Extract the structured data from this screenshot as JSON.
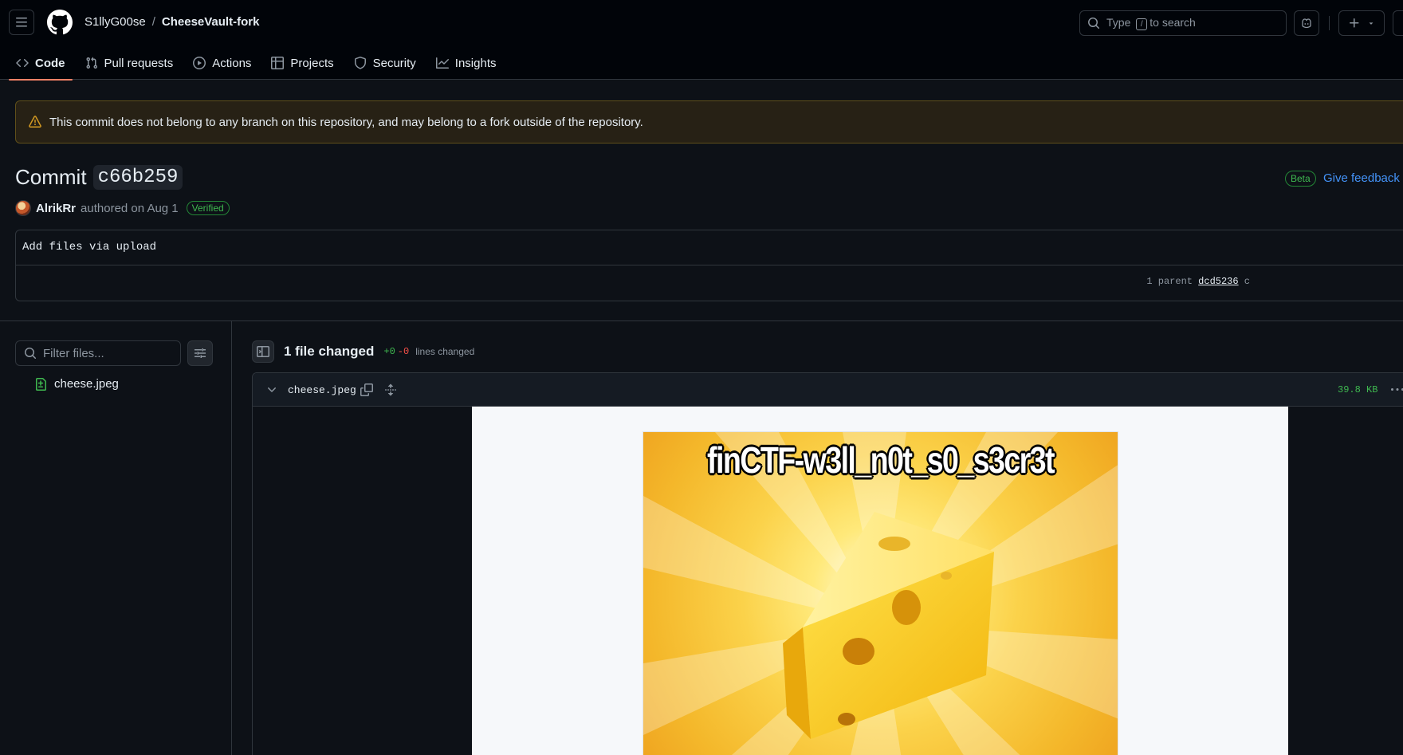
{
  "header": {
    "owner": "S1llyG00se",
    "separator": "/",
    "repo": "CheeseVault-fork",
    "search_prefix": "Type",
    "search_key": "/",
    "search_suffix": "to search"
  },
  "tabs": [
    {
      "label": "Code",
      "icon": "code-icon",
      "active": true
    },
    {
      "label": "Pull requests",
      "icon": "git-pull-request-icon"
    },
    {
      "label": "Actions",
      "icon": "play-icon"
    },
    {
      "label": "Projects",
      "icon": "table-icon"
    },
    {
      "label": "Security",
      "icon": "shield-icon"
    },
    {
      "label": "Insights",
      "icon": "graph-icon"
    }
  ],
  "banner": {
    "text": "This commit does not belong to any branch on this repository, and may belong to a fork outside of the repository.",
    "icon": "alert-icon"
  },
  "commit": {
    "title_word": "Commit",
    "sha": "c66b259",
    "beta": "Beta",
    "feedback": "Give feedback",
    "author": "AlrikRr",
    "authored": "authored on Aug 1",
    "verified": "Verified",
    "message": "Add files via upload",
    "parent_label": "1 parent",
    "parent_sha": "dcd5236",
    "parent_more": "c"
  },
  "sidebar": {
    "filter_placeholder": "Filter files...",
    "files": [
      {
        "name": "cheese.jpeg",
        "status": "added"
      }
    ]
  },
  "diff": {
    "summary": "1 file changed",
    "additions": "+0",
    "deletions": "-0",
    "lines_label": "lines changed",
    "file": {
      "name": "cheese.jpeg",
      "size": "39.8 KB",
      "image_caption": "finCTF-w3ll_n0t_s0_s3cr3t"
    }
  },
  "colors": {
    "accent_underline": "#f78166",
    "link": "#4493f8",
    "success": "#3fb950",
    "danger": "#f85149",
    "warning": "#d29922"
  }
}
